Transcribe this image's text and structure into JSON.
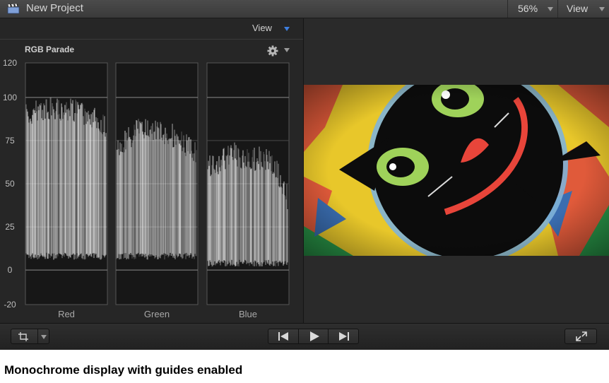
{
  "window": {
    "title": "New Project",
    "zoom": "56%",
    "view_label": "View"
  },
  "scopes": {
    "view_label": "View",
    "title": "RGB Parade",
    "y_axis": [
      "120",
      "100",
      "75",
      "50",
      "25",
      "0",
      "-20"
    ],
    "channels": [
      "Red",
      "Green",
      "Blue"
    ]
  },
  "icons": {
    "app": "clapper-icon",
    "settings": "gear-icon",
    "crop": "crop-icon",
    "prev": "skip-back-icon",
    "play": "play-icon",
    "next": "skip-forward-icon",
    "fullscreen": "fullscreen-icon"
  },
  "caption": "Monochrome display with guides enabled"
}
